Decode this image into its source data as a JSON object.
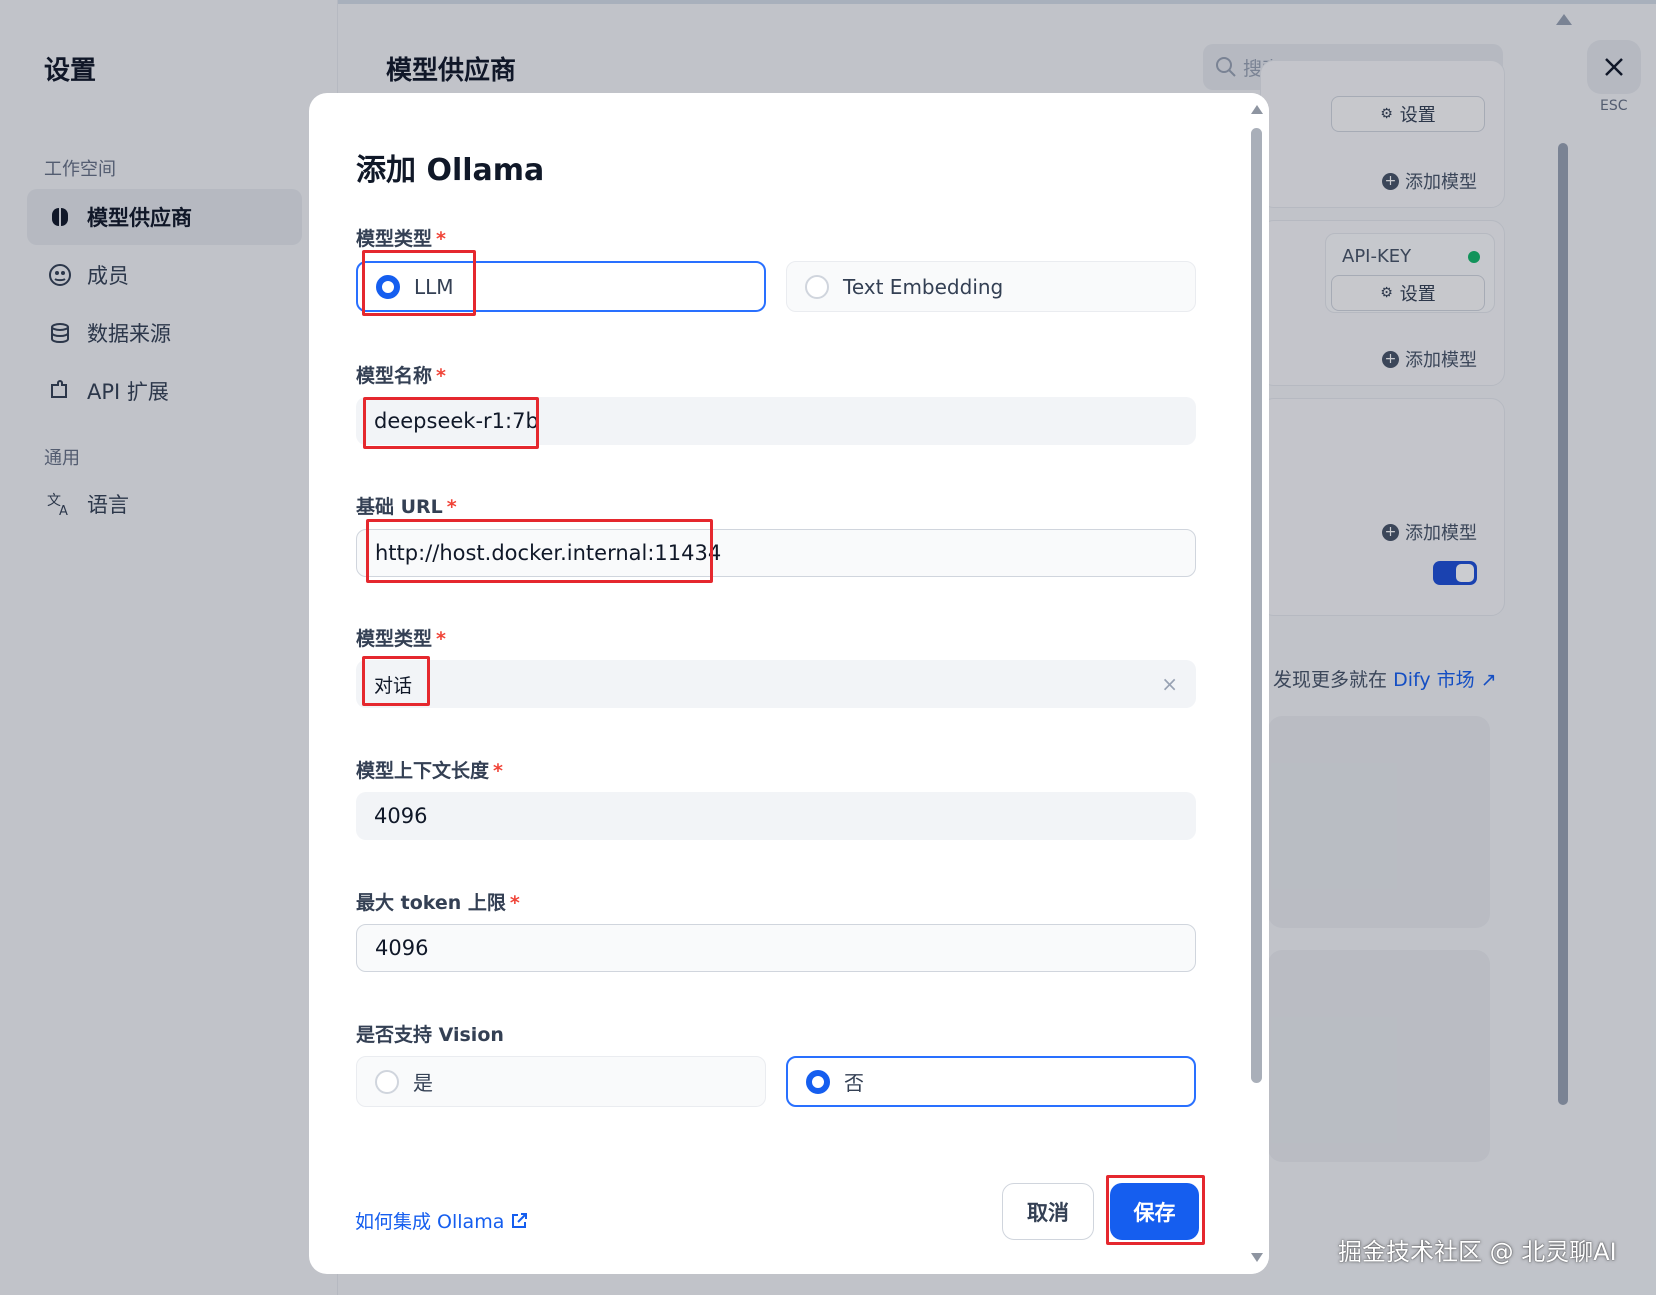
{
  "sidebar": {
    "title": "设置",
    "section_workspace": "工作空间",
    "section_general": "通用",
    "items": [
      {
        "label": "模型供应商",
        "icon": "brain-icon"
      },
      {
        "label": "成员",
        "icon": "members-icon"
      },
      {
        "label": "数据来源",
        "icon": "database-icon"
      },
      {
        "label": "API 扩展",
        "icon": "puzzle-icon"
      },
      {
        "label": "语言",
        "icon": "translate-icon"
      }
    ]
  },
  "header": {
    "title": "模型供应商",
    "search_placeholder": "搜索",
    "esc_label": "ESC"
  },
  "background_cards": {
    "settings_label": "设置",
    "add_model_label": "添加模型",
    "api_key_label": "API-KEY",
    "discover_text": "发现更多就在",
    "discover_link": "Dify 市场",
    "discover_arrow": "↗"
  },
  "modal": {
    "title": "添加 Ollama",
    "model_type": {
      "label": "模型类型",
      "required": "*",
      "options": [
        "LLM",
        "Text Embedding"
      ],
      "selected": "LLM"
    },
    "model_name": {
      "label": "模型名称",
      "required": "*",
      "value": "deepseek-r1:7b"
    },
    "base_url": {
      "label": "基础 URL",
      "required": "*",
      "value": "http://host.docker.internal:11434"
    },
    "completion_type": {
      "label": "模型类型",
      "required": "*",
      "value": "对话",
      "clear": "×"
    },
    "context_length": {
      "label": "模型上下文长度",
      "required": "*",
      "value": "4096"
    },
    "max_tokens": {
      "label": "最大 token 上限",
      "required": "*",
      "value": "4096"
    },
    "vision": {
      "label": "是否支持 Vision",
      "options": [
        "是",
        "否"
      ],
      "selected": "否"
    },
    "help_link": "如何集成 Ollama",
    "cancel_label": "取消",
    "save_label": "保存"
  },
  "watermark": "掘金技术社区 @ 北灵聊AI",
  "colors": {
    "primary": "#155eef",
    "annotation": "#e5282e",
    "required": "#f04438",
    "status_green": "#12b76a"
  }
}
